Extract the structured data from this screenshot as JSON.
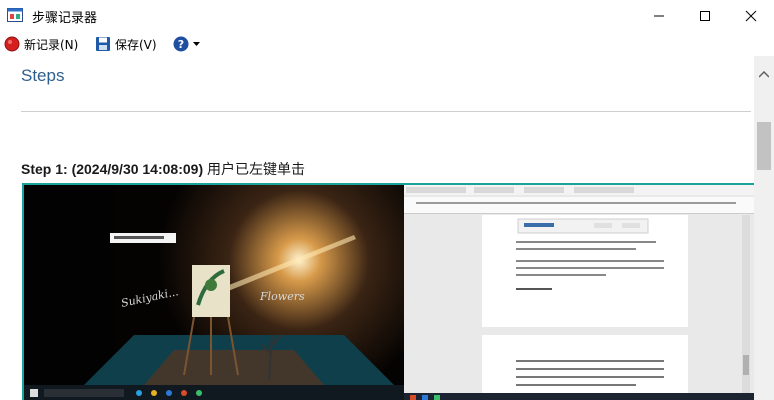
{
  "window": {
    "title": "步骤记录器",
    "minimize_icon": "minimize-icon",
    "maximize_icon": "maximize-icon",
    "close_icon": "close-icon"
  },
  "toolbar": {
    "new_record_label": "新记录(N)",
    "save_label": "保存(V)",
    "help_icon": "help-icon",
    "record_color": "#d62020",
    "save_color": "#1e5aa8",
    "help_color": "#1e4fa0"
  },
  "content": {
    "heading": "Steps",
    "step": {
      "prefix": "Step 1: (2024/9/30 14:08:09)",
      "action": " 用户已左键单击"
    }
  },
  "colors": {
    "heading": "#2d5f8f",
    "screenshot_border": "#1aa39a"
  }
}
